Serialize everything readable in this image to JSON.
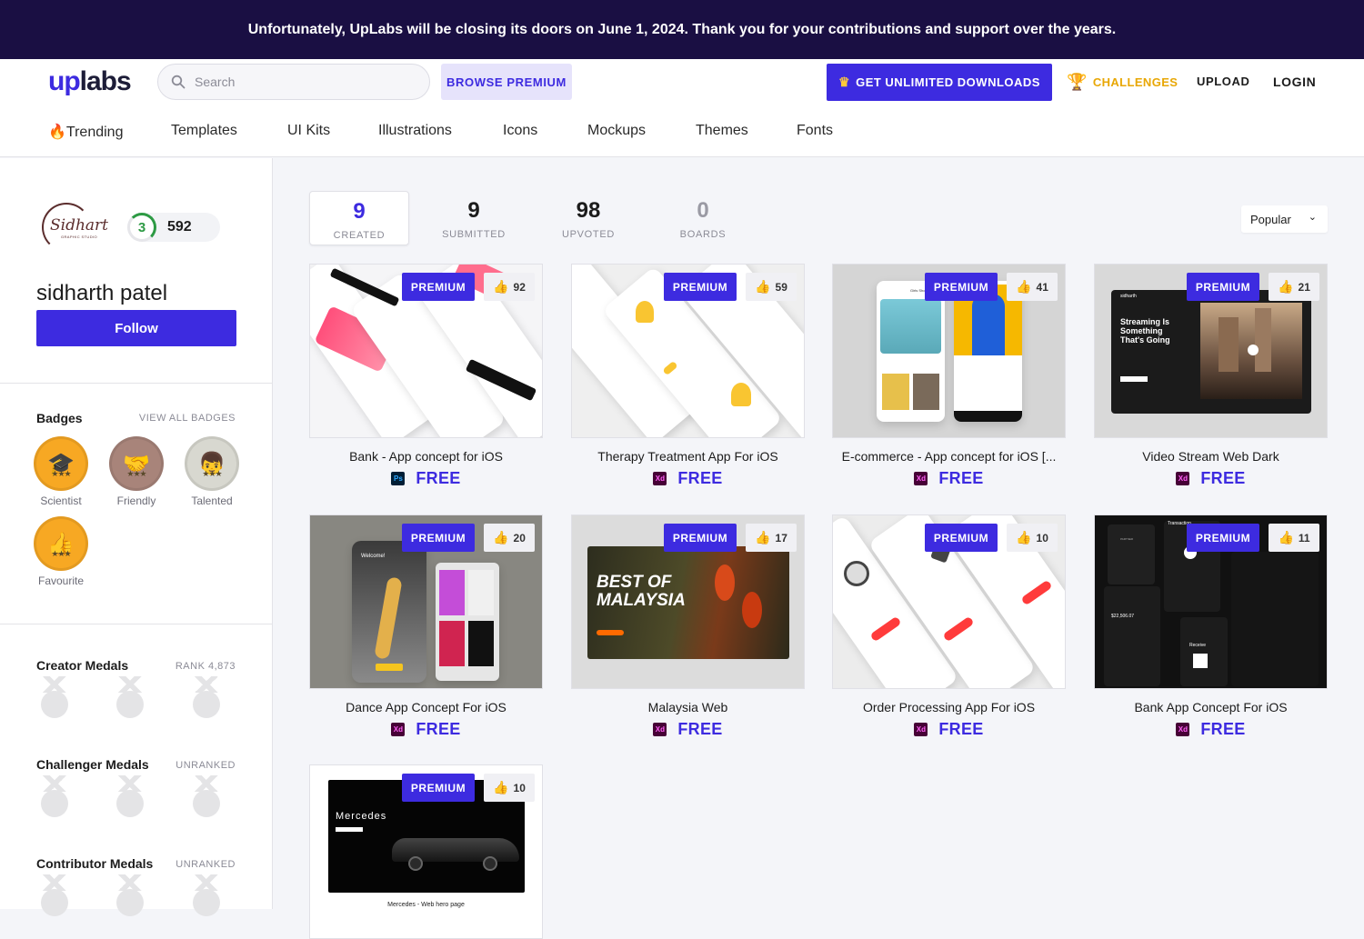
{
  "banner": {
    "text": "Unfortunately, UpLabs will be closing its doors on June 1, 2024. Thank you for your contributions and support over the years."
  },
  "header": {
    "logo_up": "up",
    "logo_labs": "labs",
    "search_placeholder": "Search",
    "browse_premium": "BROWSE PREMIUM",
    "unlimited": "GET UNLIMITED DOWNLOADS",
    "challenges": "CHALLENGES",
    "upload": "UPLOAD",
    "login": "LOGIN"
  },
  "nav": [
    {
      "label": "🔥Trending"
    },
    {
      "label": "Templates"
    },
    {
      "label": "UI Kits"
    },
    {
      "label": "Illustrations"
    },
    {
      "label": "Icons"
    },
    {
      "label": "Mockups"
    },
    {
      "label": "Themes"
    },
    {
      "label": "Fonts"
    }
  ],
  "profile": {
    "avatar_text": "Sidhart",
    "avatar_sub": "GRAPHIC STUDIO",
    "level": "3",
    "points": "592",
    "name": "sidharth patel",
    "follow": "Follow"
  },
  "badges": {
    "title": "Badges",
    "link": "VIEW ALL BADGES",
    "items": [
      {
        "label": "Scientist",
        "icon": "graduation-cap-icon",
        "glyph": "🎓",
        "stars": "★★★",
        "color": "#f7a823"
      },
      {
        "label": "Friendly",
        "icon": "handshake-icon",
        "glyph": "🤝",
        "stars": "★★★",
        "color": "#a8847a"
      },
      {
        "label": "Talented",
        "icon": "person-icon",
        "glyph": "👦",
        "stars": "★★★",
        "color": "#d8d8d0"
      },
      {
        "label": "Favourite",
        "icon": "thumbs-up-icon",
        "glyph": "👍",
        "stars": "★★★",
        "color": "#f7a823"
      }
    ]
  },
  "medals": [
    {
      "title": "Creator Medals",
      "status": "RANK 4,873"
    },
    {
      "title": "Challenger Medals",
      "status": "UNRANKED"
    },
    {
      "title": "Contributor Medals",
      "status": "UNRANKED"
    }
  ],
  "stats": [
    {
      "value": "9",
      "label": "CREATED"
    },
    {
      "value": "9",
      "label": "SUBMITTED"
    },
    {
      "value": "98",
      "label": "UPVOTED"
    },
    {
      "value": "0",
      "label": "BOARDS"
    }
  ],
  "sort": {
    "selected": "Popular"
  },
  "premium_label": "PREMIUM",
  "free_label": "FREE",
  "cards": [
    {
      "title": "Bank - App concept for iOS",
      "likes": "92",
      "tool": "Ps",
      "scene": "bank"
    },
    {
      "title": "Therapy Treatment App For iOS",
      "likes": "59",
      "tool": "Xd",
      "scene": "therapy"
    },
    {
      "title": "E-commerce - App concept for iOS [...",
      "likes": "41",
      "tool": "Xd",
      "scene": "ecom"
    },
    {
      "title": "Video Stream Web Dark",
      "likes": "21",
      "tool": "Xd",
      "scene": "video"
    },
    {
      "title": "Dance App Concept For iOS",
      "likes": "20",
      "tool": "Xd",
      "scene": "dance"
    },
    {
      "title": "Malaysia Web",
      "likes": "17",
      "tool": "Xd",
      "scene": "malaysia"
    },
    {
      "title": "Order Processing App For iOS",
      "likes": "10",
      "tool": "Xd",
      "scene": "order"
    },
    {
      "title": "Bank App Concept For iOS",
      "likes": "11",
      "tool": "Xd",
      "scene": "bank2"
    },
    {
      "title": "",
      "likes": "10",
      "tool": "Xd",
      "scene": "mercedes"
    }
  ],
  "thumb_text": {
    "streaming": "Streaming Is Something That's Going",
    "malaysia": "BEST OF MALAYSIA",
    "mercedes": "Mercedes",
    "mercedes_caption": "Mercedes - Web hero page",
    "welcome": "Welcome!",
    "girls_shop": "Girls Shop",
    "transaction": "Transaction",
    "receive": "Receive",
    "amount": "$22,506.07",
    "partner": "PARTNER",
    "sidharth": "sidharth"
  },
  "colors": {
    "brand": "#3d2be0",
    "banner": "#1a0f43",
    "gold": "#e8a705"
  }
}
